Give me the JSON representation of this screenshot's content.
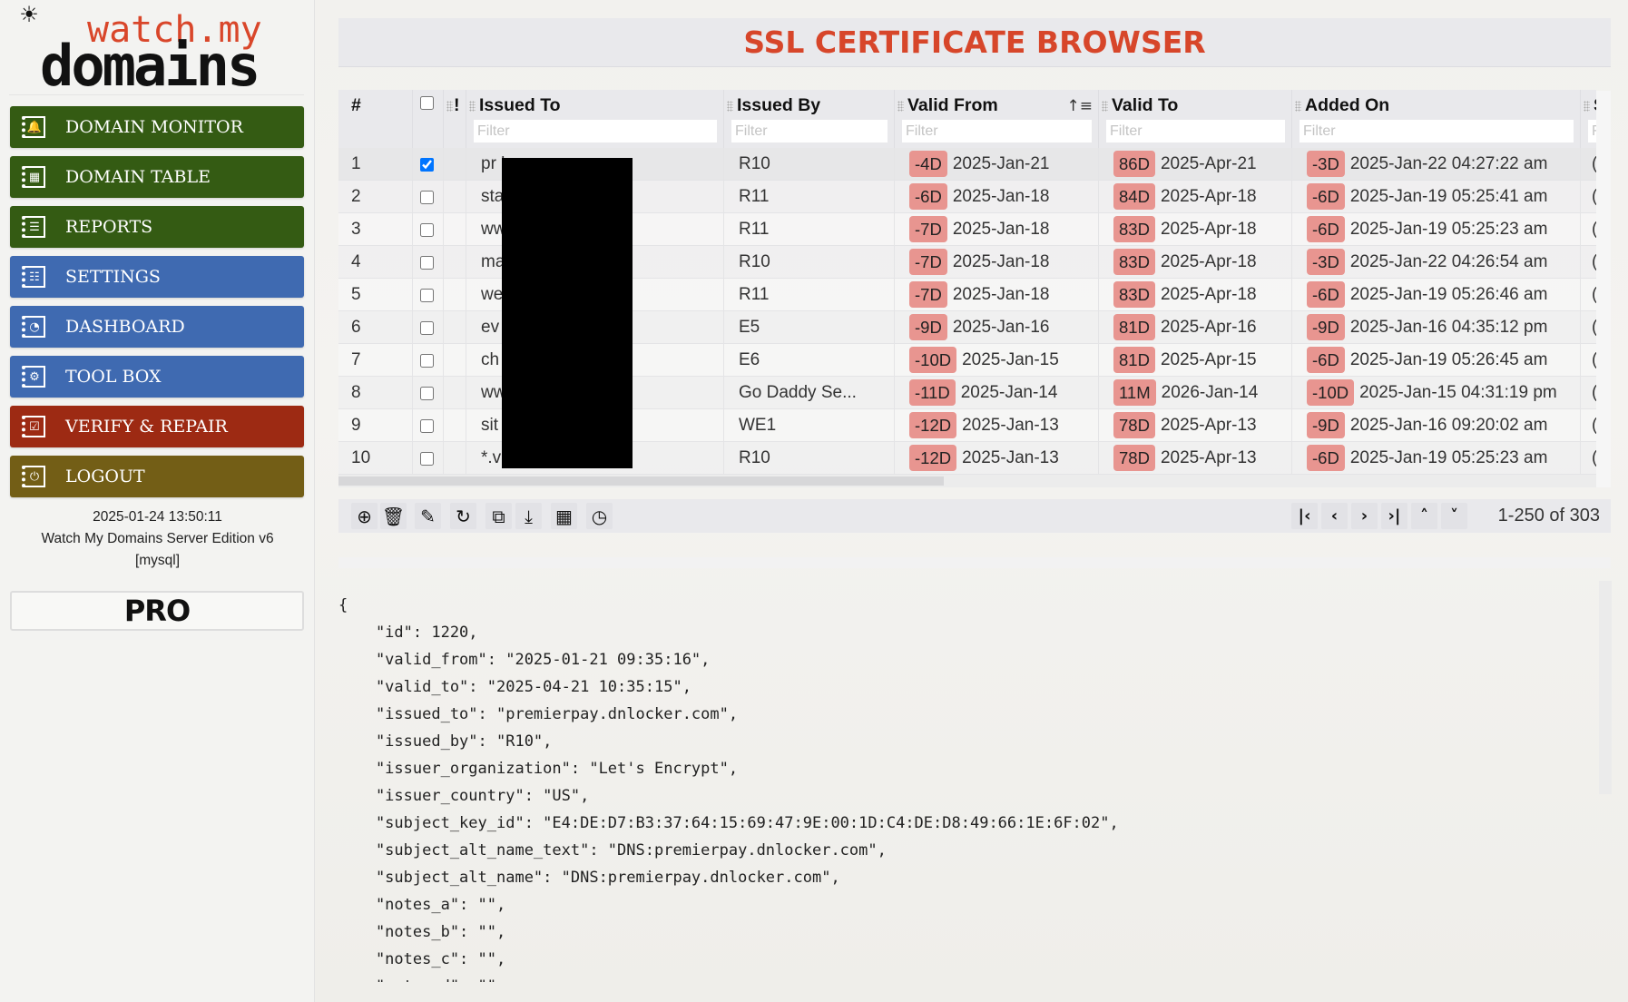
{
  "sidebar": {
    "theme_icon": "☀",
    "logo": {
      "top": "watch.my",
      "bottom": "domains"
    },
    "items": [
      {
        "label": "DOMAIN MONITOR",
        "icon": "bell-icon",
        "glyph": "🔔",
        "color": "#345b13"
      },
      {
        "label": "DOMAIN TABLE",
        "icon": "table-icon",
        "glyph": "▦",
        "color": "#345b13"
      },
      {
        "label": "REPORTS",
        "icon": "list-icon",
        "glyph": "☰",
        "color": "#345b13"
      },
      {
        "label": "SETTINGS",
        "icon": "sliders-icon",
        "glyph": "☷",
        "color": "#3f6ab1"
      },
      {
        "label": "DASHBOARD",
        "icon": "gauge-icon",
        "glyph": "◔",
        "color": "#3f6ab1"
      },
      {
        "label": "TOOL BOX",
        "icon": "gear-icon",
        "glyph": "⚙",
        "color": "#3f6ab1"
      },
      {
        "label": "VERIFY & REPAIR",
        "icon": "checklist-icon",
        "glyph": "☑",
        "color": "#9d2a13"
      },
      {
        "label": "LOGOUT",
        "icon": "power-icon",
        "glyph": "⏻",
        "color": "#735e16"
      }
    ],
    "datetime": "2025-01-24 13:50:11",
    "edition": "Watch My Domains Server Edition v6",
    "db": "[mysql]",
    "pro_label": "PRO"
  },
  "page": {
    "title": "SSL CERTIFICATE BROWSER"
  },
  "grid": {
    "columns": [
      {
        "key": "num",
        "label": "#"
      },
      {
        "key": "select",
        "label": ""
      },
      {
        "key": "flag",
        "label": "!"
      },
      {
        "key": "issued_to",
        "label": "Issued To",
        "filter_placeholder": "Filter"
      },
      {
        "key": "issued_by",
        "label": "Issued By",
        "filter_placeholder": "Filter"
      },
      {
        "key": "valid_from",
        "label": "Valid From",
        "filter_placeholder": "Filter",
        "sorted": "ascending"
      },
      {
        "key": "valid_to",
        "label": "Valid To",
        "filter_placeholder": "Filter"
      },
      {
        "key": "added_on",
        "label": "Added On",
        "filter_placeholder": "Filter"
      },
      {
        "key": "more",
        "label": "S",
        "filter_placeholder": "F"
      }
    ],
    "rows": [
      {
        "num": "1",
        "checked": true,
        "issued_to": "pr            ker.co...",
        "issued_by": "R10",
        "from_badge": "-4D",
        "valid_from": "2025-Jan-21",
        "to_badge": "86D",
        "valid_to": "2025-Apr-21",
        "added_badge": "-3D",
        "added_on": "2025-Jan-22 04:27:22 am",
        "more": "("
      },
      {
        "num": "2",
        "checked": false,
        "issued_to": "sta            o",
        "issued_by": "R11",
        "from_badge": "-6D",
        "valid_from": "2025-Jan-18",
        "to_badge": "84D",
        "valid_to": "2025-Apr-18",
        "added_badge": "-6D",
        "added_on": "2025-Jan-19 05:25:41 am",
        "more": "("
      },
      {
        "num": "3",
        "checked": false,
        "issued_to": "ww",
        "issued_by": "R11",
        "from_badge": "-7D",
        "valid_from": "2025-Jan-18",
        "to_badge": "83D",
        "valid_to": "2025-Apr-18",
        "added_badge": "-6D",
        "added_on": "2025-Jan-19 05:25:23 am",
        "more": "("
      },
      {
        "num": "4",
        "checked": false,
        "issued_to": "ma            r.com",
        "issued_by": "R10",
        "from_badge": "-7D",
        "valid_from": "2025-Jan-18",
        "to_badge": "83D",
        "valid_to": "2025-Apr-18",
        "added_badge": "-3D",
        "added_on": "2025-Jan-22 04:26:54 am",
        "more": "("
      },
      {
        "num": "5",
        "checked": false,
        "issued_to": "we",
        "issued_by": "R11",
        "from_badge": "-7D",
        "valid_from": "2025-Jan-18",
        "to_badge": "83D",
        "valid_to": "2025-Apr-18",
        "added_badge": "-6D",
        "added_on": "2025-Jan-19 05:26:46 am",
        "more": "("
      },
      {
        "num": "6",
        "checked": false,
        "issued_to": "ev            n.com",
        "issued_by": "E5",
        "from_badge": "-9D",
        "valid_from": "2025-Jan-16",
        "to_badge": "81D",
        "valid_to": "2025-Apr-16",
        "added_badge": "-9D",
        "added_on": "2025-Jan-16 04:35:12 pm",
        "more": "("
      },
      {
        "num": "7",
        "checked": false,
        "issued_to": "ch            are.io",
        "issued_by": "E6",
        "from_badge": "-10D",
        "valid_from": "2025-Jan-15",
        "to_badge": "81D",
        "valid_to": "2025-Apr-15",
        "added_badge": "-6D",
        "added_on": "2025-Jan-19 05:26:45 am",
        "more": "("
      },
      {
        "num": "8",
        "checked": false,
        "issued_to": "ww            etools....",
        "issued_by": "Go Daddy Se...",
        "from_badge": "-11D",
        "valid_from": "2025-Jan-14",
        "to_badge": "11M",
        "valid_to": "2026-Jan-14",
        "added_badge": "-10D",
        "added_on": "2025-Jan-15 04:31:19 pm",
        "more": "("
      },
      {
        "num": "9",
        "checked": false,
        "issued_to": "sit",
        "issued_by": "WE1",
        "from_badge": "-12D",
        "valid_from": "2025-Jan-13",
        "to_badge": "78D",
        "valid_to": "2025-Apr-13",
        "added_badge": "-9D",
        "added_on": "2025-Jan-16 09:20:02 am",
        "more": "("
      },
      {
        "num": "10",
        "checked": false,
        "issued_to": "*.v",
        "issued_by": "R10",
        "from_badge": "-12D",
        "valid_from": "2025-Jan-13",
        "to_badge": "78D",
        "valid_to": "2025-Apr-13",
        "added_badge": "-6D",
        "added_on": "2025-Jan-19 05:25:23 am",
        "more": "("
      }
    ],
    "badge_color": "#e89590"
  },
  "toolbar": {
    "buttons": [
      {
        "name": "add-button",
        "icon": "plus-circle-icon",
        "glyph": "⊕"
      },
      {
        "name": "delete-button",
        "icon": "trash-icon",
        "glyph": "🗑"
      },
      {
        "name": "edit-button",
        "icon": "pencil-icon",
        "glyph": "✎"
      },
      {
        "name": "refresh-button",
        "icon": "refresh-icon",
        "glyph": "↻"
      },
      {
        "name": "copy-button",
        "icon": "copy-icon",
        "glyph": "⧉"
      },
      {
        "name": "download-button",
        "icon": "download-icon",
        "glyph": "⤓"
      },
      {
        "name": "columns-settings-button",
        "icon": "table-gear-icon",
        "glyph": "▦"
      },
      {
        "name": "history-button",
        "icon": "clock-icon",
        "glyph": "◷"
      }
    ],
    "pager": [
      {
        "name": "first-page-button",
        "icon": "first-page-icon",
        "glyph": "|‹"
      },
      {
        "name": "prev-page-button",
        "icon": "chevron-left-icon",
        "glyph": "‹"
      },
      {
        "name": "next-page-button",
        "icon": "chevron-right-icon",
        "glyph": "›"
      },
      {
        "name": "last-page-button",
        "icon": "last-page-icon",
        "glyph": "›|"
      },
      {
        "name": "scroll-up-button",
        "icon": "chevron-up-icon",
        "glyph": "˄"
      },
      {
        "name": "scroll-down-button",
        "icon": "chevron-down-icon",
        "glyph": "˅"
      }
    ],
    "range": "1-250 of 303"
  },
  "detail": {
    "lines": [
      "{",
      "    \"id\": 1220,",
      "    \"valid_from\": \"2025-01-21 09:35:16\",",
      "    \"valid_to\": \"2025-04-21 10:35:15\",",
      "    \"issued_to\": \"premierpay.dnlocker.com\",",
      "    \"issued_by\": \"R10\",",
      "    \"issuer_organization\": \"Let's Encrypt\",",
      "    \"issuer_country\": \"US\",",
      "    \"subject_key_id\": \"E4:DE:D7:B3:37:64:15:69:47:9E:00:1D:C4:DE:D8:49:66:1E:6F:02\",",
      "    \"subject_alt_name_text\": \"DNS:premierpay.dnlocker.com\",",
      "    \"subject_alt_name\": \"DNS:premierpay.dnlocker.com\",",
      "    \"notes_a\": \"\",",
      "    \"notes_b\": \"\",",
      "    \"notes_c\": \"\",",
      "    \"notes_d\": \"\""
    ]
  }
}
